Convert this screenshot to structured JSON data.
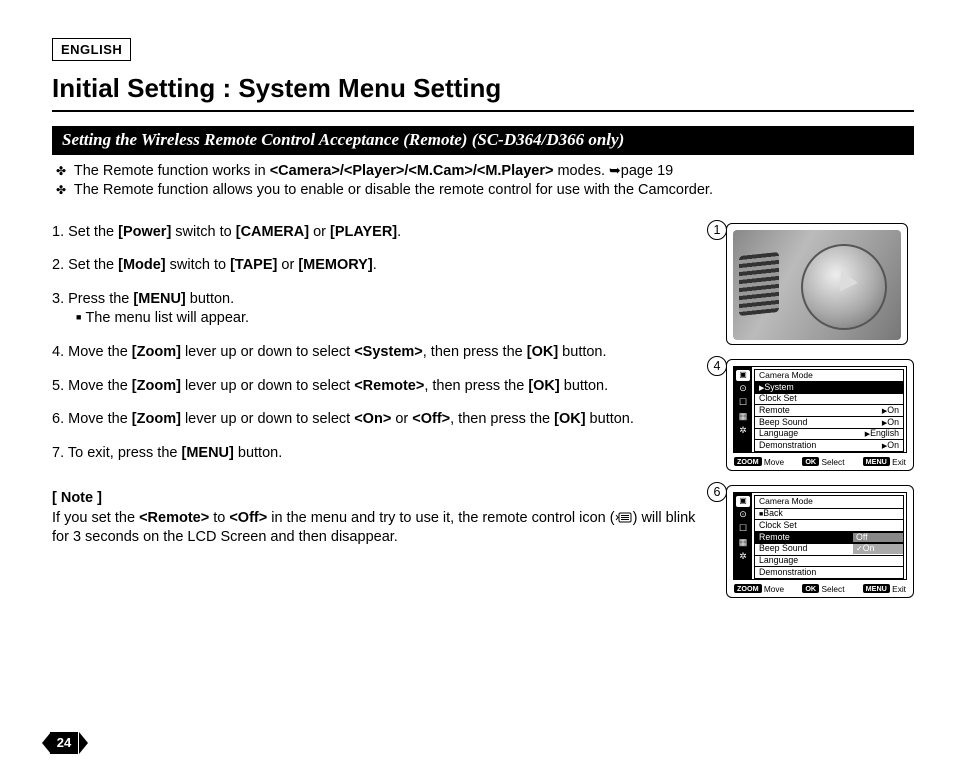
{
  "lang_box": "ENGLISH",
  "title": "Initial Setting : System Menu Setting",
  "section_bar": "Setting the Wireless Remote Control Acceptance (Remote) (SC-D364/D366 only)",
  "intro1_pre": "The Remote function works in ",
  "intro1_bold": "<Camera>/<Player>/<M.Cam>/<M.Player>",
  "intro1_post": " modes. ",
  "intro1_ref": "page 19",
  "intro2": "The Remote function allows you to enable or disable the remote control for use with the Camcorder.",
  "steps": {
    "s1": {
      "n": "1. Set the ",
      "b1": "[Power]",
      "m": " switch to ",
      "b2": "[CAMERA]",
      "or": " or ",
      "b3": "[PLAYER]",
      "end": "."
    },
    "s2": {
      "n": "2. Set the ",
      "b1": "[Mode]",
      "m": " switch to ",
      "b2": "[TAPE]",
      "or": " or ",
      "b3": "[MEMORY]",
      "end": "."
    },
    "s3": {
      "n": "3. Press the ",
      "b1": "[MENU]",
      "end": " button."
    },
    "s3a": "The menu list will appear.",
    "s4": {
      "n": "4. Move the ",
      "b1": "[Zoom]",
      "m1": " lever up or down to select ",
      "b2": "<System>",
      "m2": ", then press the ",
      "b3": "[OK]",
      "end": " button."
    },
    "s5": {
      "n": "5. Move the ",
      "b1": "[Zoom]",
      "m1": " lever up or down to select ",
      "b2": "<Remote>",
      "m2": ", then press the ",
      "b3": "[OK]",
      "end": " button."
    },
    "s6": {
      "n": "6. Move the ",
      "b1": "[Zoom]",
      "m1": " lever up or down to select ",
      "b2": "<On>",
      "or": " or ",
      "b3": "<Off>",
      "m2": ", then press the ",
      "b4": "[OK]",
      "end": " button."
    },
    "s7": {
      "n": "7. To exit, press the ",
      "b1": "[MENU]",
      "end": " button."
    }
  },
  "note": {
    "hdr": "[ Note ]",
    "t1": "If you set the ",
    "b1": "<Remote>",
    "t2": " to ",
    "b2": "<Off>",
    "t3": " in the menu and try to use it, the remote control icon (",
    "t4": ") will blink for 3 seconds on the LCD Screen and then disappear."
  },
  "fig_nums": {
    "a": "1",
    "b": "4",
    "c": "6"
  },
  "lcd4": {
    "title": "Camera Mode",
    "rows": [
      {
        "label": "System",
        "val": "",
        "sel": true,
        "pre": "▶"
      },
      {
        "label": "Clock Set",
        "val": ""
      },
      {
        "label": "Remote",
        "val": "On",
        "arr": true
      },
      {
        "label": "Beep Sound",
        "val": "On",
        "arr": true
      },
      {
        "label": "Language",
        "val": "English",
        "arr": true
      },
      {
        "label": "Demonstration",
        "val": "On",
        "arr": true
      }
    ]
  },
  "lcd6": {
    "title": "Camera Mode",
    "rows": [
      {
        "label": "Back",
        "pre": "■"
      },
      {
        "label": "Clock Set"
      },
      {
        "label": "Remote",
        "sel": true,
        "opt_off": "Off",
        "opt_on": "On"
      },
      {
        "label": "Beep Sound"
      },
      {
        "label": "Language"
      },
      {
        "label": "Demonstration"
      }
    ]
  },
  "footer": {
    "zoom": "ZOOM",
    "move": "Move",
    "ok": "OK",
    "select": "Select",
    "menu": "MENU",
    "exit": "Exit"
  },
  "page_number": "24"
}
